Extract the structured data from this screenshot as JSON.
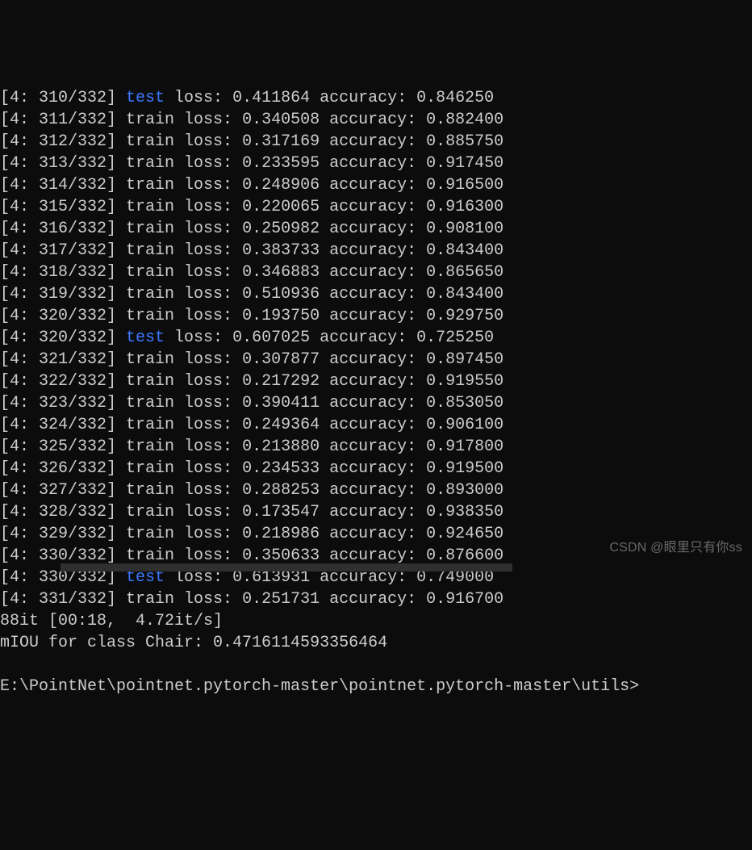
{
  "lines": [
    {
      "prefix": "[4: 310/332]",
      "kw": "test",
      "loss": "0.411864",
      "acc": "0.846250"
    },
    {
      "prefix": "[4: 311/332]",
      "kw": "train",
      "loss": "0.340508",
      "acc": "0.882400"
    },
    {
      "prefix": "[4: 312/332]",
      "kw": "train",
      "loss": "0.317169",
      "acc": "0.885750"
    },
    {
      "prefix": "[4: 313/332]",
      "kw": "train",
      "loss": "0.233595",
      "acc": "0.917450"
    },
    {
      "prefix": "[4: 314/332]",
      "kw": "train",
      "loss": "0.248906",
      "acc": "0.916500"
    },
    {
      "prefix": "[4: 315/332]",
      "kw": "train",
      "loss": "0.220065",
      "acc": "0.916300"
    },
    {
      "prefix": "[4: 316/332]",
      "kw": "train",
      "loss": "0.250982",
      "acc": "0.908100"
    },
    {
      "prefix": "[4: 317/332]",
      "kw": "train",
      "loss": "0.383733",
      "acc": "0.843400"
    },
    {
      "prefix": "[4: 318/332]",
      "kw": "train",
      "loss": "0.346883",
      "acc": "0.865650"
    },
    {
      "prefix": "[4: 319/332]",
      "kw": "train",
      "loss": "0.510936",
      "acc": "0.843400"
    },
    {
      "prefix": "[4: 320/332]",
      "kw": "train",
      "loss": "0.193750",
      "acc": "0.929750"
    },
    {
      "prefix": "[4: 320/332]",
      "kw": "test",
      "loss": "0.607025",
      "acc": "0.725250"
    },
    {
      "prefix": "[4: 321/332]",
      "kw": "train",
      "loss": "0.307877",
      "acc": "0.897450"
    },
    {
      "prefix": "[4: 322/332]",
      "kw": "train",
      "loss": "0.217292",
      "acc": "0.919550"
    },
    {
      "prefix": "[4: 323/332]",
      "kw": "train",
      "loss": "0.390411",
      "acc": "0.853050"
    },
    {
      "prefix": "[4: 324/332]",
      "kw": "train",
      "loss": "0.249364",
      "acc": "0.906100"
    },
    {
      "prefix": "[4: 325/332]",
      "kw": "train",
      "loss": "0.213880",
      "acc": "0.917800"
    },
    {
      "prefix": "[4: 326/332]",
      "kw": "train",
      "loss": "0.234533",
      "acc": "0.919500"
    },
    {
      "prefix": "[4: 327/332]",
      "kw": "train",
      "loss": "0.288253",
      "acc": "0.893000"
    },
    {
      "prefix": "[4: 328/332]",
      "kw": "train",
      "loss": "0.173547",
      "acc": "0.938350"
    },
    {
      "prefix": "[4: 329/332]",
      "kw": "train",
      "loss": "0.218986",
      "acc": "0.924650"
    },
    {
      "prefix": "[4: 330/332]",
      "kw": "train",
      "loss": "0.350633",
      "acc": "0.876600"
    },
    {
      "prefix": "[4: 330/332]",
      "kw": "test",
      "loss": "0.613931",
      "acc": "0.749000"
    },
    {
      "prefix": "[4: 331/332]",
      "kw": "train",
      "loss": "0.251731",
      "acc": "0.916700"
    }
  ],
  "loss_label": " loss: ",
  "acc_label": " accuracy: ",
  "progress_line": "88it [00:18,  4.72it/s]",
  "miou_line": "mIOU for class Chair: 0.4716114593356464",
  "blank_line": " ",
  "prompt_line": "E:\\PointNet\\pointnet.pytorch-master\\pointnet.pytorch-master\\utils>",
  "watermark": "CSDN @眼里只有你ss"
}
